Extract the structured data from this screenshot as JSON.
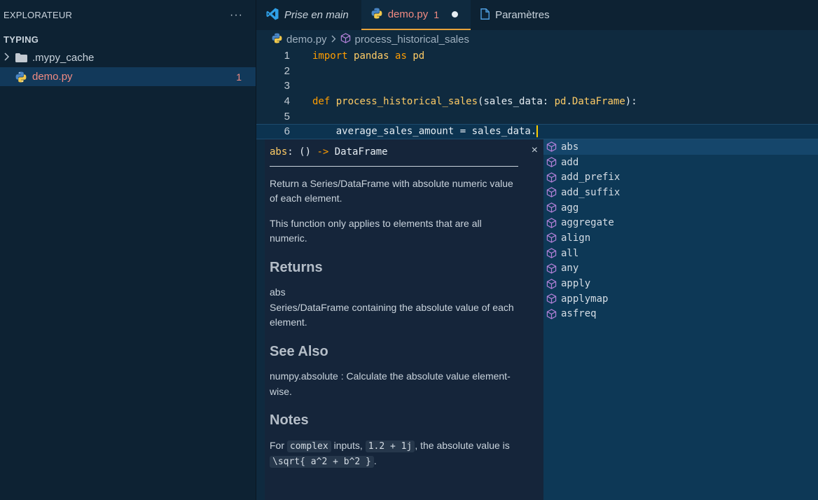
{
  "sidebar": {
    "title": "EXPLORATEUR",
    "more": "···",
    "section": "TYPING",
    "items": [
      {
        "label": ".mypy_cache",
        "icon": "folder-icon"
      },
      {
        "label": "demo.py",
        "icon": "python-icon",
        "badge": "1"
      }
    ]
  },
  "tabs": [
    {
      "label": "Prise en main",
      "icon": "vscode-icon"
    },
    {
      "label": "demo.py",
      "errors": "1",
      "icon": "python-icon"
    },
    {
      "label": "Paramètres",
      "icon": "file-icon"
    }
  ],
  "breadcrumb": {
    "file": "demo.py",
    "symbol": "process_historical_sales"
  },
  "code": {
    "numbers": [
      "1",
      "2",
      "3",
      "4",
      "5",
      "6"
    ],
    "l1": {
      "kw1": "import",
      "mod": "pandas",
      "kw2": "as",
      "alias": "pd"
    },
    "l4": {
      "kw": "def",
      "fn": "process_historical_sales",
      "open": "(sales_data: ",
      "ty_mod": "pd",
      "dot": ".",
      "ty": "DataFrame",
      "close": "):"
    },
    "l6": {
      "text": "    average_sales_amount = sales_data."
    }
  },
  "doc": {
    "sig_name": "abs",
    "sig_mid": ": () ",
    "sig_arrow": "->",
    "sig_ret": " DataFrame",
    "close": "×",
    "p1": "Return a Series/DataFrame with absolute numeric value of each element.",
    "p2": "This function only applies to elements that are all numeric.",
    "h_returns": "Returns",
    "ret_name": "abs",
    "ret_desc": "Series/DataFrame containing the absolute value of each element.",
    "h_see": "See Also",
    "see": "numpy.absolute : Calculate the absolute value element-wise.",
    "h_notes": "Notes",
    "notes_a": "For ",
    "notes_code1": "complex",
    "notes_b": " inputs, ",
    "notes_code2": "1.2 + 1j",
    "notes_c": ", the absolute value is ",
    "notes_code3": "\\sqrt{ a^2 + b^2 }",
    "notes_d": "."
  },
  "suggestions": [
    "abs",
    "add",
    "add_prefix",
    "add_suffix",
    "agg",
    "aggregate",
    "align",
    "all",
    "any",
    "apply",
    "applymap",
    "asfreq"
  ],
  "colors": {
    "accent": "#e8a33b",
    "error": "#f28b82",
    "keyword": "#ff9d00",
    "identifier": "#ffcc66"
  }
}
